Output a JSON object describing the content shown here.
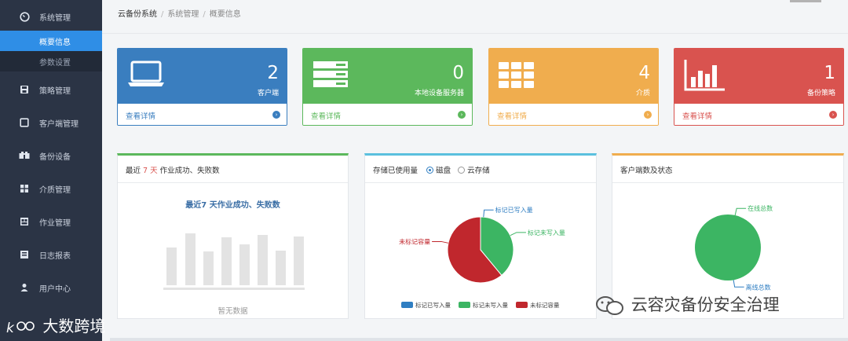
{
  "sidebar": {
    "items": [
      {
        "label": "系统管理",
        "icon": "dashboard-icon"
      },
      {
        "label": "策略管理",
        "icon": "floppy-icon"
      },
      {
        "label": "客户端管理",
        "icon": "monitor-icon"
      },
      {
        "label": "备份设备",
        "icon": "device-icon"
      },
      {
        "label": "介质管理",
        "icon": "grid-icon"
      },
      {
        "label": "作业管理",
        "icon": "calendar-icon"
      },
      {
        "label": "日志报表",
        "icon": "report-icon"
      },
      {
        "label": "用户中心",
        "icon": "user-icon"
      }
    ],
    "subitems": [
      {
        "label": "概要信息",
        "active": true
      },
      {
        "label": "参数设置",
        "active": false
      }
    ]
  },
  "breadcrumb": [
    "云备份系统",
    "系统管理",
    "概要信息"
  ],
  "cards": [
    {
      "count": "2",
      "caption": "客户端",
      "link": "查看详情",
      "color": "#3a7ebf",
      "icon": "laptop-icon"
    },
    {
      "count": "0",
      "caption": "本地设备服务器",
      "link": "查看详情",
      "color": "#5cb85c",
      "icon": "server-icon"
    },
    {
      "count": "4",
      "caption": "介质",
      "link": "查看详情",
      "color": "#f0ad4e",
      "icon": "grid-icon"
    },
    {
      "count": "1",
      "caption": "备份策略",
      "link": "查看详情",
      "color": "#d9534f",
      "icon": "barchart-icon"
    }
  ],
  "panel_jobs": {
    "title_prefix": "最近 ",
    "title_days": "7 天",
    "title_suffix": " 作业成功、失败数",
    "chart_title": "最近7 天作业成功、失败数",
    "empty_text": "暂无数据",
    "accent": "#5cb85c"
  },
  "panel_storage": {
    "title": "存储已使用量",
    "radio_disk": "磁盘",
    "radio_cloud": "云存储",
    "accent": "#5bc0de",
    "chart_data": {
      "type": "pie",
      "series": [
        {
          "name": "标记已写入量",
          "value": 0,
          "color": "#2f7ec2"
        },
        {
          "name": "标记未写入量",
          "value": 0.39,
          "color": "#3cb563"
        },
        {
          "name": "未标记容量",
          "value": 0.61,
          "color": "#c0272d"
        }
      ]
    }
  },
  "panel_clients": {
    "title": "客户端数及状态",
    "accent": "#f0ad4e",
    "chart_data": {
      "type": "pie",
      "series": [
        {
          "name": "在线总数",
          "value": 1,
          "color": "#3cb563"
        },
        {
          "name": "离线总数",
          "value": 0,
          "color": "#2f7ec2"
        }
      ]
    }
  },
  "watermarks": {
    "right": "云容灾备份安全治理",
    "left": "大数跨境"
  }
}
